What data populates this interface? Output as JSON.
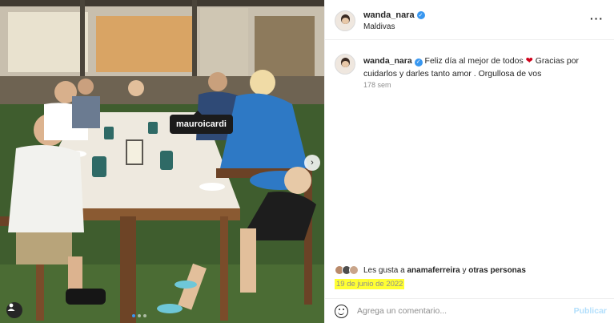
{
  "photo": {
    "tag_label": "mauroicardi",
    "carousel_count": 3,
    "carousel_active": 1
  },
  "header": {
    "username": "wanda_nara",
    "location": "Maldivas",
    "more_icon": "more-horizontal-icon"
  },
  "caption": {
    "username": "wanda_nara",
    "text_before": "Feliz día al mejor de todos",
    "text_after": "Gracias por cuidarlos y darles tanto amor . Orgullosa de vos",
    "age": "178 sem"
  },
  "likes": {
    "prefix": "Les gusta a",
    "user": "anamaferreira",
    "connector": "y",
    "others": "otras personas"
  },
  "date": "19 de junio de 2022",
  "comment": {
    "placeholder": "Agrega un comentario...",
    "post_label": "Publicar"
  },
  "colors": {
    "accent": "#3897f0",
    "date_highlight": "#ffff33",
    "post_button": "#b2dffc"
  }
}
